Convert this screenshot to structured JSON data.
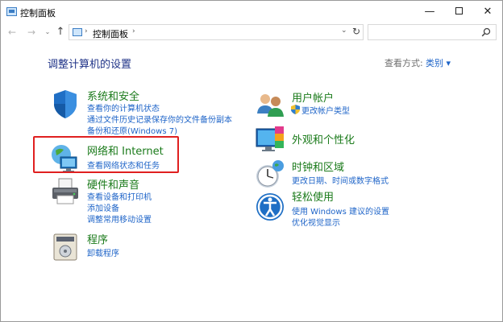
{
  "window": {
    "title": "控制面板",
    "min_glyph": "—",
    "close_glyph": "✕"
  },
  "nav": {
    "back_glyph": "←",
    "forward_glyph": "→",
    "recent_glyph": "⌄",
    "up_glyph": "↑",
    "address_separator": "›",
    "address_text": "控制面板",
    "dropdown_glyph": "⌄",
    "refresh_glyph": "↻",
    "search_placeholder": ""
  },
  "content": {
    "page_title": "调整计算机的设置",
    "view_by_label": "查看方式:",
    "view_by_value": "类别 ▾"
  },
  "categories": {
    "security": {
      "title": "系统和安全",
      "links": [
        "查看你的计算机状态",
        "通过文件历史记录保存你的文件备份副本",
        "备份和还原(Windows 7)"
      ]
    },
    "network": {
      "title": "网络和 Internet",
      "links": [
        "查看网络状态和任务"
      ]
    },
    "hardware": {
      "title": "硬件和声音",
      "links": [
        "查看设备和打印机",
        "添加设备",
        "调整常用移动设置"
      ]
    },
    "programs": {
      "title": "程序",
      "links": [
        "卸载程序"
      ]
    },
    "users": {
      "title": "用户帐户",
      "links": [
        "更改帐户类型"
      ]
    },
    "appearance": {
      "title": "外观和个性化",
      "links": []
    },
    "clock": {
      "title": "时钟和区域",
      "links": [
        "更改日期、时间或数字格式"
      ]
    },
    "ease": {
      "title": "轻松使用",
      "links": [
        "使用 Windows 建议的设置",
        "优化视觉显示"
      ]
    }
  },
  "colors": {
    "category_title": "#1a7a1a",
    "link": "#1e64c8",
    "page_title": "#1e3287",
    "highlight_box": "#e02020"
  }
}
